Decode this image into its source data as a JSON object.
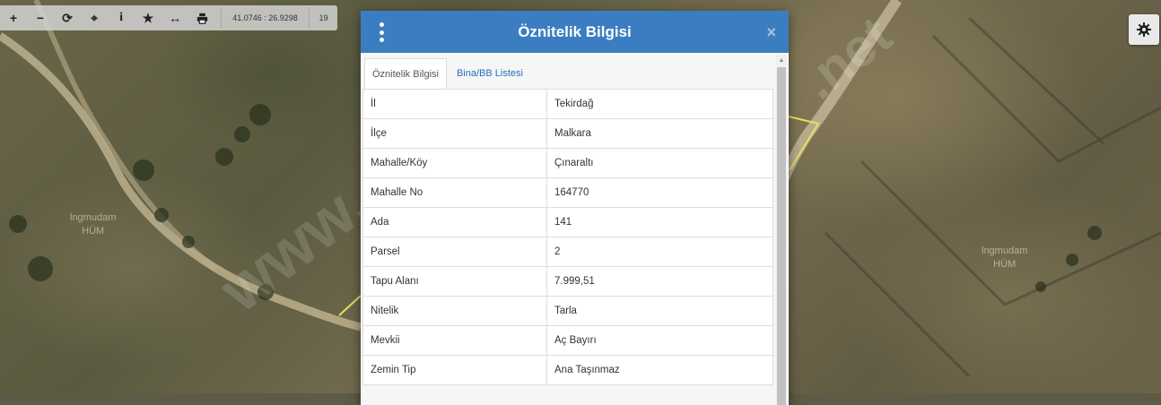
{
  "toolbar": {
    "buttons": [
      {
        "icon": "plus-icon",
        "glyph": "+"
      },
      {
        "icon": "minus-icon",
        "glyph": "−"
      },
      {
        "icon": "refresh-icon",
        "glyph": "⟳"
      },
      {
        "icon": "crosshair-icon",
        "glyph": "⌖"
      },
      {
        "icon": "info-icon",
        "glyph": "i"
      },
      {
        "icon": "star-icon",
        "glyph": "★"
      },
      {
        "icon": "measure-icon",
        "glyph": "↔"
      },
      {
        "icon": "print-icon",
        "glyph": ""
      }
    ],
    "coordinates": "41.0746 : 26.9298",
    "zoom_level": "19"
  },
  "map": {
    "labels": [
      "lngmudam\nHÜM",
      "lngmudam\nHÜM"
    ],
    "watermark": "www.",
    "watermark2": ".net"
  },
  "settings": {
    "icon": "gear-icon"
  },
  "dialog": {
    "title": "Öznitelik Bilgisi",
    "menu_icon": "vertical-dots-icon",
    "close": "×",
    "tabs": [
      "Öznitelik Bilgisi",
      "Bina/BB Listesi"
    ],
    "rows": [
      {
        "key": "İl",
        "value": "Tekirdağ"
      },
      {
        "key": "İlçe",
        "value": "Malkara"
      },
      {
        "key": "Mahalle/Köy",
        "value": "Çınaraltı"
      },
      {
        "key": "Mahalle No",
        "value": "164770"
      },
      {
        "key": "Ada",
        "value": "141"
      },
      {
        "key": "Parsel",
        "value": "2"
      },
      {
        "key": "Tapu Alanı",
        "value": "7.999,51"
      },
      {
        "key": "Nitelik",
        "value": "Tarla"
      },
      {
        "key": "Mevkii",
        "value": "Aç Bayırı"
      },
      {
        "key": "Zemin Tip",
        "value": "Ana Taşınmaz"
      }
    ]
  }
}
